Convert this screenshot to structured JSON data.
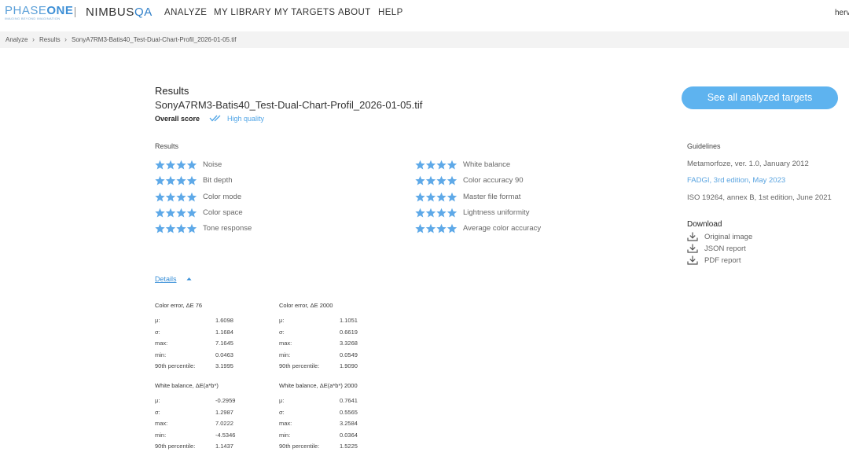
{
  "brand": {
    "phase_light": "PHASE",
    "phase_bold": "ONE",
    "tagline": "IMAGING BEYOND IMAGINATION",
    "nimbus_main": "NIMBUS",
    "nimbus_accent": "QA"
  },
  "nav": [
    "ANALYZE",
    "MY LIBRARY",
    "MY TARGETS",
    "ABOUT",
    "HELP"
  ],
  "user": "herv",
  "breadcrumb": [
    "Analyze",
    "Results",
    "SonyA7RM3-Batis40_Test-Dual-Chart-Profil_2026-01-05.tif"
  ],
  "header": {
    "title": "Results",
    "filename": "SonyA7RM3-Batis40_Test-Dual-Chart-Profil_2026-01-05.tif",
    "score_label": "Overall score",
    "score_value": "High quality",
    "see_all_button": "See all analyzed targets"
  },
  "results": {
    "label": "Results",
    "stars_max": 4,
    "left": [
      {
        "label": "Noise",
        "stars": 4
      },
      {
        "label": "Bit depth",
        "stars": 4
      },
      {
        "label": "Color mode",
        "stars": 4
      },
      {
        "label": "Color space",
        "stars": 4
      },
      {
        "label": "Tone response",
        "stars": 4
      }
    ],
    "right": [
      {
        "label": "White balance",
        "stars": 4
      },
      {
        "label": "Color accuracy 90",
        "stars": 4
      },
      {
        "label": "Master file format",
        "stars": 4
      },
      {
        "label": "Lightness uniformity",
        "stars": 4
      },
      {
        "label": "Average color accuracy",
        "stars": 4
      }
    ]
  },
  "guidelines": {
    "label": "Guidelines",
    "items": [
      "Metamorfoze, ver. 1.0, January 2012",
      "FADGI, 3rd edition, May 2023",
      "ISO 19264, annex B, 1st edition, June 2021"
    ]
  },
  "download": {
    "label": "Download",
    "items": [
      "Original image",
      "JSON report",
      "PDF report"
    ]
  },
  "details": {
    "label": "Details",
    "groups": [
      {
        "title": "Color error, ΔE 76",
        "rows": [
          [
            "μ:",
            "1.6098"
          ],
          [
            "σ:",
            "1.1684"
          ],
          [
            "max:",
            "7.1645"
          ],
          [
            "min:",
            "0.0463"
          ],
          [
            "90th percentile:",
            "3.1995"
          ]
        ]
      },
      {
        "title": "Color error, ΔE 2000",
        "rows": [
          [
            "μ:",
            "1.1051"
          ],
          [
            "σ:",
            "0.6619"
          ],
          [
            "max:",
            "3.3268"
          ],
          [
            "min:",
            "0.0549"
          ],
          [
            "90th percentile:",
            "1.9090"
          ]
        ]
      },
      {
        "title": "White balance, ΔE(a*b*)",
        "rows": [
          [
            "μ:",
            "-0.2959"
          ],
          [
            "σ:",
            "1.2987"
          ],
          [
            "max:",
            "7.0222"
          ],
          [
            "min:",
            "-4.5346"
          ],
          [
            "90th percentile:",
            "1.1437"
          ]
        ]
      },
      {
        "title": "White balance, ΔE(a*b*) 2000",
        "rows": [
          [
            "μ:",
            "0.7641"
          ],
          [
            "σ:",
            "0.5565"
          ],
          [
            "max:",
            "3.2584"
          ],
          [
            "min:",
            "0.0364"
          ],
          [
            "90th percentile:",
            "1.5225"
          ]
        ]
      }
    ]
  },
  "colors": {
    "accent": "#5eb3ef",
    "star": "#5ea9e8",
    "link": "#3a90d8"
  }
}
